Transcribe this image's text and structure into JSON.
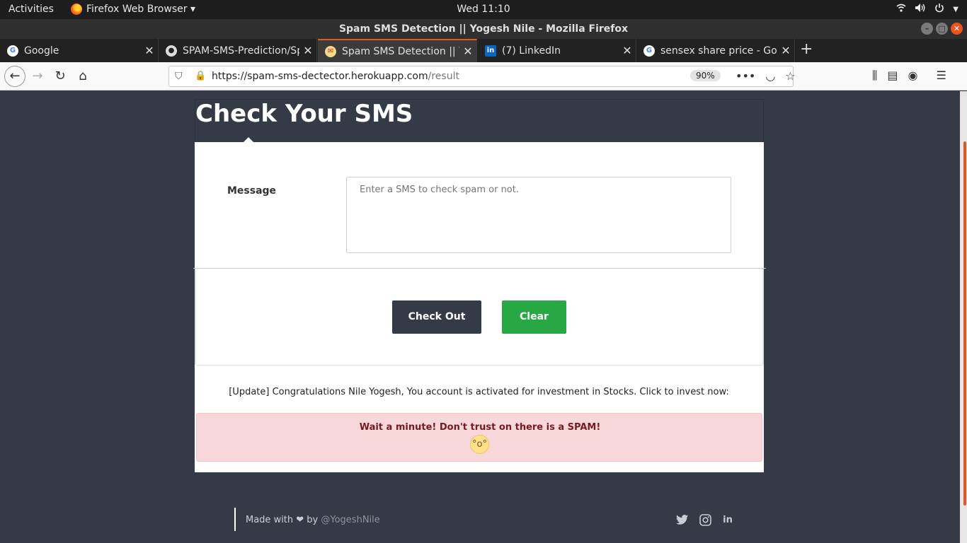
{
  "topbar": {
    "activities": "Activities",
    "app_menu": "Firefox Web Browser ▾",
    "clock": "Wed 11:10"
  },
  "window": {
    "title": "Spam SMS Detection || Yogesh Nile - Mozilla Firefox"
  },
  "tabs": [
    {
      "label": "Google",
      "icon": "google-icon"
    },
    {
      "label": "SPAM-SMS-Prediction/Sp",
      "icon": "github-icon"
    },
    {
      "label": "Spam SMS Detection || Yo",
      "icon": "site-icon",
      "active": true
    },
    {
      "label": "(7) LinkedIn",
      "icon": "linkedin-icon"
    },
    {
      "label": "sensex share price - Goo",
      "icon": "google-icon"
    }
  ],
  "navbar": {
    "url_host": "https://spam-sms-dectector.herokuapp.com",
    "url_path": "/result",
    "zoom": "90%"
  },
  "page": {
    "title": "Check Your SMS",
    "message_label": "Message",
    "message_placeholder": "Enter a SMS to check spam or not.",
    "check_button": "Check Out",
    "clear_button": "Clear",
    "result_message": "[Update] Congratulations Nile Yogesh, You account is activated for investment in Stocks. Click to invest now:",
    "alert_text": "Wait a minute! Don't trust on there is a SPAM!"
  },
  "footer": {
    "made_with": "Made with ❤ by",
    "handle": "@YogeshNile"
  },
  "colors": {
    "accent": "#e95420",
    "page_bg": "#343a46",
    "clear_green": "#28a745",
    "alert_bg": "#f8d7da"
  }
}
